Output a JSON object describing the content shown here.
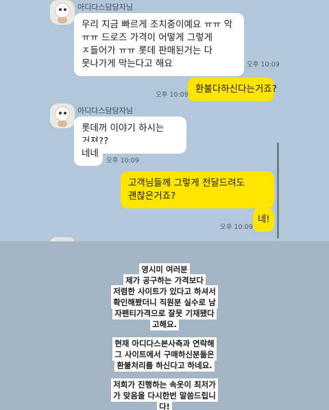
{
  "chat": {
    "messages": [
      {
        "sender": "아디다스담당자님",
        "text": "우리 지금 빠르게 조치중이예요 ㅠㅠ 악 ㅠㅠ 드로즈 가격이 어떻게 그렇게 ㅈ들어가 ㅠㅠ 롯데 판매된거는 다 못나가게 막는다고 해요",
        "time": "오후 10:09"
      },
      {
        "text": "환불다하신다는거죠?",
        "time": "오후 10:09"
      },
      {
        "sender": "아디다스담당자님",
        "text": "롯데꺼 이야기 하시는 거져??"
      },
      {
        "text": "네네",
        "time": "오후 10:09"
      },
      {
        "text": "고객님들께 그렇게 전달드려도 괜찮은거죠?"
      },
      {
        "text": "네!",
        "time": "오후 10:09"
      }
    ]
  },
  "notice": {
    "paragraphs": [
      {
        "lines": [
          "영시미 여러분",
          "제가 공구하는 가격보다",
          "저렴한 사이트가 있다고 하셔서",
          "확인해봤더니 직원분 실수로 남",
          "자팬티가격으로 잘못 기재됐다",
          "고해요."
        ]
      },
      {
        "lines": [
          "현재 아디다스본사측과 연락해",
          "그 사이트에서 구매하신분들은",
          "환불처리를 하신다고 하네요."
        ]
      },
      {
        "lines": [
          "저희가 진행하는 속옷이 최저가",
          "가 맞음을 다시한번 말씀드립니",
          "다!"
        ]
      }
    ]
  }
}
